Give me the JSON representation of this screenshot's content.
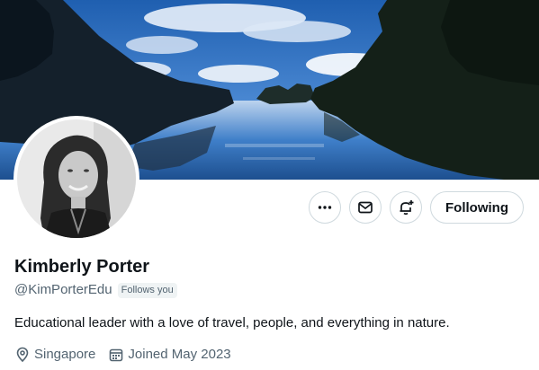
{
  "profile": {
    "display_name": "Kimberly Porter",
    "handle": "@KimPorterEdu",
    "follows_you": "Follows you",
    "bio": "Educational leader with a love of travel, people, and everything in nature.",
    "location": "Singapore",
    "joined": "Joined May 2023"
  },
  "actions": {
    "more_icon": "more-horizontal-icon",
    "message_icon": "envelope-icon",
    "notify_icon": "bell-plus-icon",
    "following_label": "Following"
  },
  "icons": {
    "location": "map-pin-icon",
    "joined": "calendar-icon"
  },
  "colors": {
    "text_primary": "#0f1419",
    "text_secondary": "#536471",
    "border": "#cfd9de",
    "badge_bg": "#eff3f4"
  }
}
